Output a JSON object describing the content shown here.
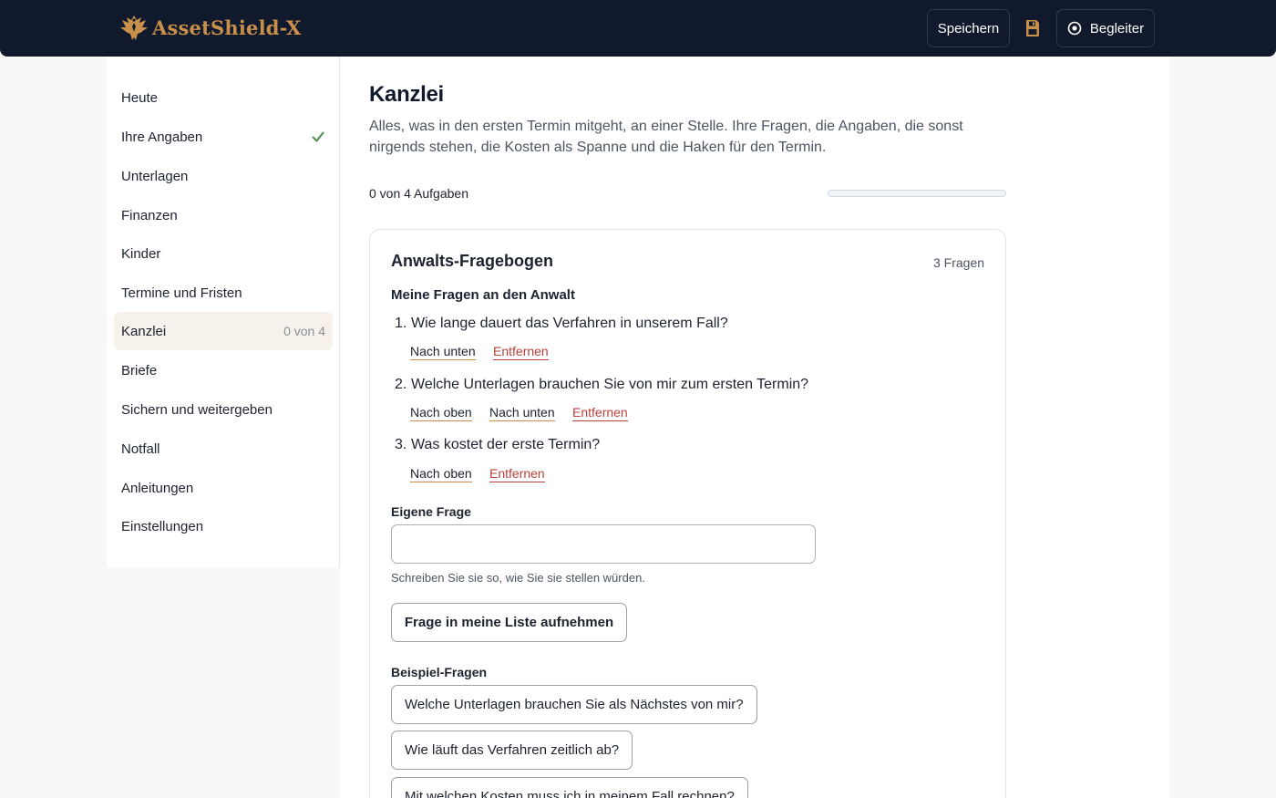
{
  "brand": {
    "name": "AssetShield-X",
    "accent": "#c8904a",
    "header_bg": "#111a2c"
  },
  "header": {
    "save_label": "Speichern",
    "save_icon": "floppy-disk-icon",
    "companion_label": "Begleiter",
    "companion_icon": "radio-target-icon"
  },
  "sidebar": {
    "items": [
      {
        "label": "Heute",
        "meta": ""
      },
      {
        "label": "Ihre Angaben",
        "meta": "",
        "done": true
      },
      {
        "label": "Unterlagen",
        "meta": ""
      },
      {
        "label": "Finanzen",
        "meta": ""
      },
      {
        "label": "Kinder",
        "meta": ""
      },
      {
        "label": "Termine und Fristen",
        "meta": ""
      },
      {
        "label": "Kanzlei",
        "meta": "0 von 4",
        "active": true
      },
      {
        "label": "Briefe",
        "meta": ""
      },
      {
        "label": "Sichern und weitergeben",
        "meta": ""
      },
      {
        "label": "Notfall",
        "meta": ""
      },
      {
        "label": "Anleitungen",
        "meta": ""
      },
      {
        "label": "Einstellungen",
        "meta": ""
      }
    ]
  },
  "main": {
    "title": "Kanzlei",
    "description": "Alles, was in den ersten Termin mitgeht, an einer Stelle. Ihre Fragen, die Angaben, die sonst nirgends stehen, die Kosten als Spanne und die Haken für den Termin.",
    "progress_text": "0 von 4 Aufgaben",
    "progress_fraction": 0
  },
  "questionnaire": {
    "title": "Anwalts-Fragebogen",
    "count": "3 Fragen",
    "subheading": "Meine Fragen an den Anwalt",
    "questions": [
      {
        "num": "1.",
        "text": "Wie lange dauert das Verfahren in unserem Fall?",
        "actions": [
          "Nach unten",
          "Entfernen"
        ]
      },
      {
        "num": "2.",
        "text": "Welche Unterlagen brauchen Sie von mir zum ersten Termin?",
        "actions": [
          "Nach oben",
          "Nach unten",
          "Entfernen"
        ]
      },
      {
        "num": "3.",
        "text": "Was kostet der erste Termin?",
        "actions": [
          "Nach oben",
          "Entfernen"
        ]
      }
    ],
    "own_question_label": "Eigene Frage",
    "own_question_value": "",
    "own_question_hint": "Schreiben Sie sie so, wie Sie sie stellen würden.",
    "add_button": "Frage in meine Liste aufnehmen",
    "examples_label": "Beispiel-Fragen",
    "examples": [
      "Welche Unterlagen brauchen Sie als Nächstes von mir?",
      "Wie läuft das Verfahren zeitlich ab?",
      "Mit welchen Kosten muss ich in meinem Fall rechnen?"
    ]
  }
}
